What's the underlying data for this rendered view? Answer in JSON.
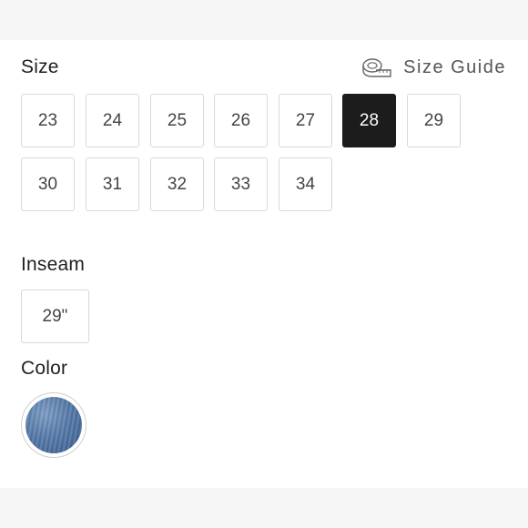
{
  "size": {
    "label": "Size",
    "guide_label": "Size Guide",
    "guide_icon": "measuring-tape-icon",
    "options": [
      "23",
      "24",
      "25",
      "26",
      "27",
      "28",
      "29",
      "30",
      "31",
      "32",
      "33",
      "34"
    ],
    "selected": "28"
  },
  "inseam": {
    "label": "Inseam",
    "options": [
      "29\""
    ]
  },
  "color": {
    "label": "Color",
    "swatch_color": "#5479a8"
  },
  "colors": {
    "selected_bg": "#1c1c1c",
    "border": "#d9d9d9"
  }
}
